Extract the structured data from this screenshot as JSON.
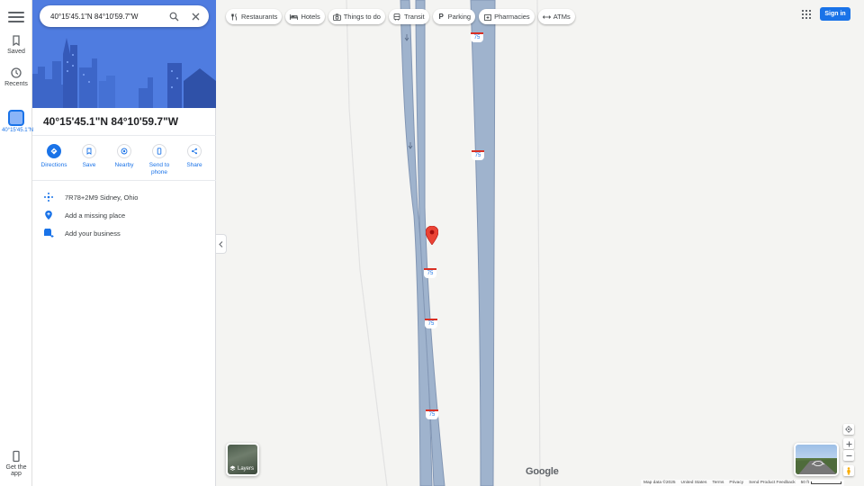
{
  "search": {
    "value": "40°15'45.1\"N 84°10'59.7\"W"
  },
  "rail": {
    "saved_label": "Saved",
    "recents_label": "Recents",
    "place_label": "40°15'45.1\"N",
    "get_app_label": "Get the app"
  },
  "place": {
    "title": "40°15'45.1\"N 84°10'59.7\"W",
    "actions": [
      {
        "label": "Directions",
        "icon": "directions-icon"
      },
      {
        "label": "Save",
        "icon": "bookmark-icon"
      },
      {
        "label": "Nearby",
        "icon": "nearby-icon"
      },
      {
        "label": "Send to phone",
        "icon": "phone-icon"
      },
      {
        "label": "Share",
        "icon": "share-icon"
      }
    ],
    "plus_code": "7R78+2M9 Sidney, Ohio",
    "add_missing_place": "Add a missing place",
    "add_business": "Add your business"
  },
  "chips": [
    {
      "label": "Restaurants",
      "icon": "fork-knife-icon"
    },
    {
      "label": "Hotels",
      "icon": "bed-icon"
    },
    {
      "label": "Things to do",
      "icon": "camera-icon"
    },
    {
      "label": "Transit",
      "icon": "train-icon"
    },
    {
      "label": "Parking",
      "icon": "parking-icon"
    },
    {
      "label": "Pharmacies",
      "icon": "pharmacy-icon"
    },
    {
      "label": "ATMs",
      "icon": "atm-icon"
    }
  ],
  "header": {
    "sign_in": "Sign in"
  },
  "map": {
    "highway_shields": [
      "75",
      "75",
      "75",
      "75",
      "75"
    ],
    "layers_label": "Layers",
    "google_logo": "Google",
    "footer": {
      "data": "Map data ©2025",
      "region": "United States",
      "terms": "Terms",
      "privacy": "Privacy",
      "feedback": "Send Product Feedback",
      "scale": "50 ft"
    },
    "colors": {
      "road": "#9fb3cd",
      "road_edge": "#8296b4",
      "pin": "#ea4335",
      "background": "#f4f4f2"
    }
  }
}
